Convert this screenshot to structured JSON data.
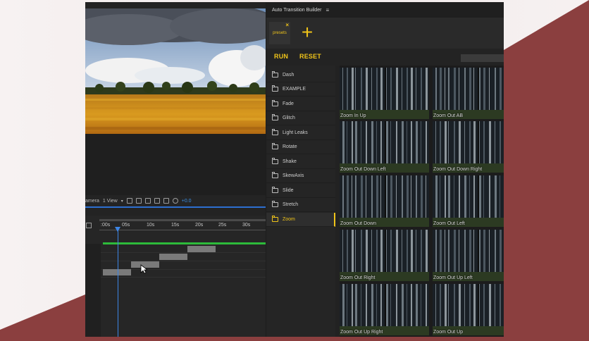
{
  "colors": {
    "accent": "#f0c419",
    "playhead": "#3d86e6",
    "green_bar": "#2dbb3a",
    "maroon_bg": "#8b3f3f"
  },
  "viewer_toolbar": {
    "camera_label": "amera",
    "view_label": "1 View",
    "offset_value": "+0.0"
  },
  "timeline": {
    "ticks": [
      ":00s",
      "05s",
      "10s",
      "15s",
      "20s",
      "25s",
      "30s"
    ]
  },
  "panel": {
    "title": "Auto Transition Builder",
    "menu_icon": "hamburger-icon",
    "preset_tab": "presets",
    "close_icon": "close-icon",
    "add_icon": "plus-icon",
    "run_label": "RUN",
    "reset_label": "RESET"
  },
  "folders": [
    {
      "label": "Dash",
      "selected": false
    },
    {
      "label": "EXAMPLE",
      "selected": false
    },
    {
      "label": "Fade",
      "selected": false
    },
    {
      "label": "Glitch",
      "selected": false
    },
    {
      "label": "Light Leaks",
      "selected": false
    },
    {
      "label": "Rotate",
      "selected": false
    },
    {
      "label": "Shake",
      "selected": false
    },
    {
      "label": "SkewAxis",
      "selected": false
    },
    {
      "label": "Slide",
      "selected": false
    },
    {
      "label": "Stretch",
      "selected": false
    },
    {
      "label": "Zoom",
      "selected": true
    }
  ],
  "presets": [
    "Zoom In Up",
    "Zoom Out AB",
    "Zoom Out Down Left",
    "Zoom Out Down Right",
    "Zoom Out Down",
    "Zoom Out Left",
    "Zoom Out Right",
    "Zoom Out Up Left",
    "Zoom Out Up Right",
    "Zoom Out Up"
  ]
}
